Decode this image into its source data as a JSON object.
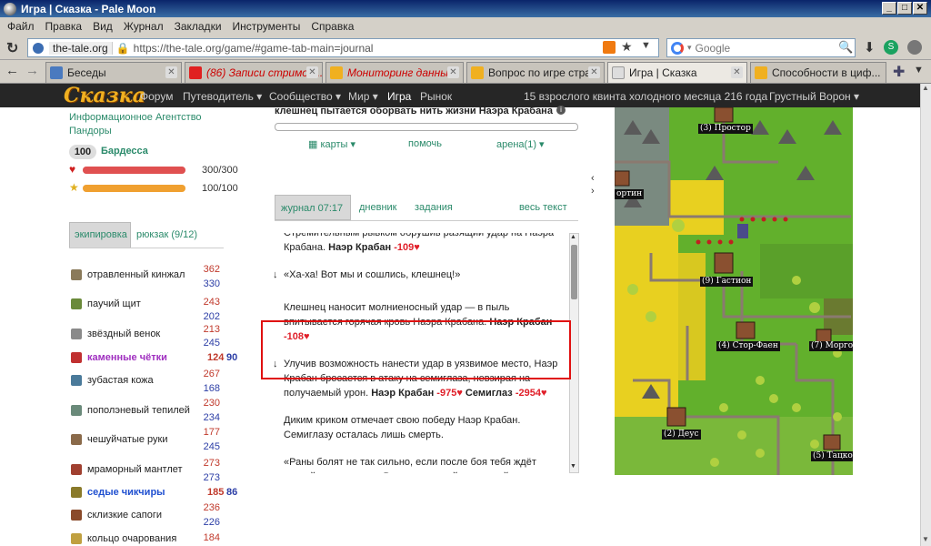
{
  "window": {
    "title": "Игра | Сказка - Pale Moon"
  },
  "menu": [
    "Файл",
    "Правка",
    "Вид",
    "Журнал",
    "Закладки",
    "Инструменты",
    "Справка"
  ],
  "address": {
    "site": "the-tale.org",
    "url": "https://the-tale.org/game/#game-tab-main=journal"
  },
  "search": {
    "placeholder": "Google"
  },
  "tabs": [
    {
      "label": "Беседы",
      "color": "#4a7abf"
    },
    {
      "label": "(86) Записи стримов...",
      "color": "#e02020"
    },
    {
      "label": "Мониторинг данны...",
      "color": "#f0b020"
    },
    {
      "label": "Вопрос по игре стра...",
      "color": "#f0b020"
    },
    {
      "label": "Игра | Сказка",
      "color": "#bbb"
    },
    {
      "label": "Способности в циф...",
      "color": "#f0b020"
    }
  ],
  "site": {
    "logo": "Сказка",
    "nav": [
      "Форум",
      "Путеводитель ▾",
      "Сообщество ▾",
      "Мир ▾",
      "Игра",
      "Рынок"
    ],
    "date": "15 взрослого квинта холодного месяца 216 года",
    "user": "Грустный Ворон ▾"
  },
  "hero": {
    "affil_line1": "Информационное Агентство",
    "affil_line2": "Пандоры",
    "level": "100",
    "class": "Бардесса",
    "hp": "300/300",
    "hp_fraction": 1.0,
    "exp": "100/100",
    "exp_fraction": 1.0
  },
  "equip_tabs": {
    "active": "экипировка",
    "other": "рюкзак (9/12)"
  },
  "equipment": [
    {
      "name": "отравленный кинжал",
      "v1": "362",
      "v2": "330",
      "style": "normal",
      "icon": "dagger-icon",
      "color": "#8a7a5a"
    },
    {
      "name": "паучий щит",
      "v1": "243",
      "v2": "202",
      "style": "normal",
      "icon": "shield-icon",
      "color": "#6a8a3a"
    },
    {
      "name": "звёздный венок",
      "v1": "213",
      "v2": "245",
      "style": "normal",
      "icon": "wreath-icon",
      "color": "#8a8a8a"
    },
    {
      "name": "каменные чётки",
      "v1": "124",
      "v2": "90",
      "style": "epic",
      "icon": "beads-icon",
      "color": "#c03030"
    },
    {
      "name": "зубастая кожа",
      "v1": "267",
      "v2": "168",
      "style": "normal",
      "icon": "leather-icon",
      "color": "#4a7a9a"
    },
    {
      "name": "пополэневый тепилей",
      "v1": "230",
      "v2": "234",
      "style": "normal",
      "icon": "helmet-icon",
      "color": "#6a8a7a"
    },
    {
      "name": "чешуйчатые руки",
      "v1": "177",
      "v2": "245",
      "style": "normal",
      "icon": "gloves-icon",
      "color": "#8a6a4a"
    },
    {
      "name": "мраморный мантлет",
      "v1": "273",
      "v2": "273",
      "style": "normal",
      "icon": "mantle-icon",
      "color": "#a04030"
    },
    {
      "name": "седые чикчиры",
      "v1": "185",
      "v2": "86",
      "style": "rare",
      "icon": "pants-icon",
      "color": "#8a7a2a"
    },
    {
      "name": "склизкие сапоги",
      "v1": "236",
      "v2": "226",
      "style": "normal",
      "icon": "boots-icon",
      "color": "#8a4a2a"
    },
    {
      "name": "кольцо очарования",
      "v1": "184",
      "v2": "",
      "style": "normal",
      "icon": "ring-icon",
      "color": "#c0a040"
    }
  ],
  "action": {
    "text": "клешнец пытается оборвать нить жизни Наэра Крабана",
    "progress": 0.0
  },
  "controls": {
    "cards": "карты ▾",
    "help": "помочь",
    "arena": "арена(1) ▾"
  },
  "log_tabs": {
    "journal": "журнал 07:17",
    "diary": "дневник",
    "quests": "задания",
    "all_text": "весь текст"
  },
  "log": [
    {
      "arrow": "",
      "text": "Стремительным рывком обрушив разящий удар на Наэра Крабана.",
      "name": "Наэр Крабан",
      "dmg": "-109♥",
      "name2": "",
      "dmg2": ""
    },
    {
      "arrow": "↓",
      "text": "«Ха-ха! Вот мы и сошлись, клешнец!»",
      "name": "",
      "dmg": "",
      "name2": "",
      "dmg2": ""
    },
    {
      "arrow": "",
      "text": "Клешнец наносит молниеносный удар — в пыль впитывается горячая кровь Наэра Крабана.",
      "name": "Наэр Крабан",
      "dmg": "-108♥",
      "name2": "",
      "dmg2": ""
    },
    {
      "arrow": "↓",
      "text": "Улучив возможность нанести удар в уязвимое место, Наэр Крабан бросается в атаку на семиглаза, невзирая на получаемый урон.",
      "name": "Наэр Крабан",
      "dmg": "-975♥",
      "name2": "Семиглаз",
      "dmg2": "-2954♥"
    },
    {
      "arrow": "",
      "text": "Диким криком отмечает свою победу Наэр Крабан. Семиглазу осталась лишь смерть.",
      "name": "",
      "dmg": "",
      "name2": "",
      "dmg2": ""
    },
    {
      "arrow": "",
      "text": "«Раны болят не так сильно, если после боя тебя ждёт достойная награда... Вот прекрасный тараканий ус, положим его в рюкзак... Хм-м, определённо, самочувствие стало лучше».",
      "name": "",
      "dmg": "",
      "name2": "",
      "dmg2": ""
    }
  ],
  "map": {
    "towns": [
      {
        "label": "(3) Простор"
      },
      {
        "label": "ортин"
      },
      {
        "label": "(9) Гастион"
      },
      {
        "label": "(4) Стор-Фаен"
      },
      {
        "label": "(7) Моргор"
      },
      {
        "label": "(2) Деус"
      },
      {
        "label": "(5) Тацкор"
      }
    ]
  }
}
